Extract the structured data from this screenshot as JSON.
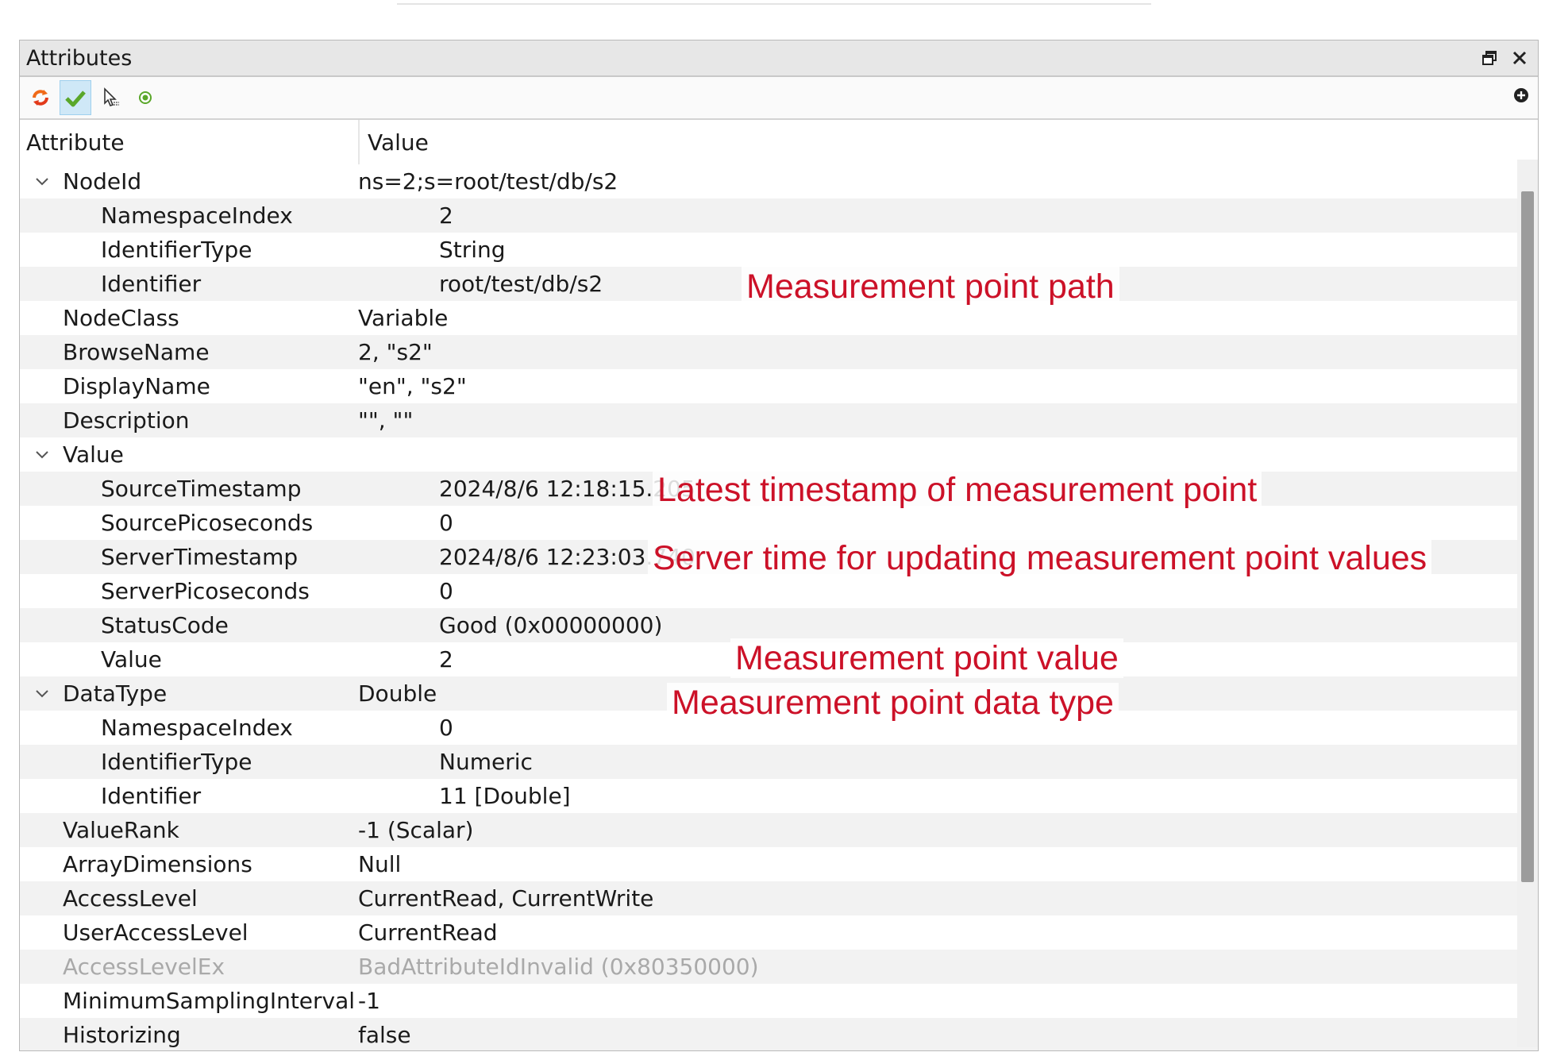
{
  "panel": {
    "title": "Attributes"
  },
  "toolbar": {
    "icons": [
      "refresh-icon",
      "check-icon",
      "pointer-icon",
      "radio-icon",
      "add-circle-icon"
    ]
  },
  "table": {
    "header": {
      "attribute": "Attribute",
      "value": "Value"
    },
    "rows": [
      {
        "name": "NodeId",
        "value": "ns=2;s=root/test/db/s2",
        "level": 0,
        "expanded": true
      },
      {
        "name": "NamespaceIndex",
        "value": "2",
        "level": 1
      },
      {
        "name": "IdentifierType",
        "value": "String",
        "level": 1
      },
      {
        "name": "Identifier",
        "value": "root/test/db/s2",
        "level": 1
      },
      {
        "name": "NodeClass",
        "value": "Variable",
        "level": 0
      },
      {
        "name": "BrowseName",
        "value": "2, \"s2\"",
        "level": 0
      },
      {
        "name": "DisplayName",
        "value": "\"en\", \"s2\"",
        "level": 0
      },
      {
        "name": "Description",
        "value": "\"\", \"\"",
        "level": 0
      },
      {
        "name": "Value",
        "value": "",
        "level": 0,
        "expanded": true
      },
      {
        "name": "SourceTimestamp",
        "value": "2024/8/6 12:18:15.205",
        "level": 1
      },
      {
        "name": "SourcePicoseconds",
        "value": "0",
        "level": 1
      },
      {
        "name": "ServerTimestamp",
        "value": "2024/8/6 12:23:03.740",
        "level": 1
      },
      {
        "name": "ServerPicoseconds",
        "value": "0",
        "level": 1
      },
      {
        "name": "StatusCode",
        "value": "Good (0x00000000)",
        "level": 1
      },
      {
        "name": "Value",
        "value": "2",
        "level": 1
      },
      {
        "name": "DataType",
        "value": "Double",
        "level": 0,
        "expanded": true
      },
      {
        "name": "NamespaceIndex",
        "value": "0",
        "level": 1
      },
      {
        "name": "IdentifierType",
        "value": "Numeric",
        "level": 1
      },
      {
        "name": "Identifier",
        "value": "11 [Double]",
        "level": 1
      },
      {
        "name": "ValueRank",
        "value": "-1 (Scalar)",
        "level": 0
      },
      {
        "name": "ArrayDimensions",
        "value": "Null",
        "level": 0
      },
      {
        "name": "AccessLevel",
        "value": "CurrentRead, CurrentWrite",
        "level": 0
      },
      {
        "name": "UserAccessLevel",
        "value": "CurrentRead",
        "level": 0
      },
      {
        "name": "AccessLevelEx",
        "value": "BadAttributeIdInvalid (0x80350000)",
        "level": 0,
        "disabled": true
      },
      {
        "name": "MinimumSamplingInterval",
        "value": "-1",
        "level": 0
      },
      {
        "name": "Historizing",
        "value": "false",
        "level": 0
      }
    ]
  },
  "annotations": {
    "path": "Measurement point path",
    "source_ts": "Latest timestamp of measurement point",
    "server_ts": "Server time for updating measurement point values",
    "value": "Measurement point value",
    "data_type": "Measurement point data type"
  },
  "colors": {
    "annotation": "#cc1128",
    "alt_row": "#f2f2f2",
    "disabled_text": "#a9a9a9"
  }
}
